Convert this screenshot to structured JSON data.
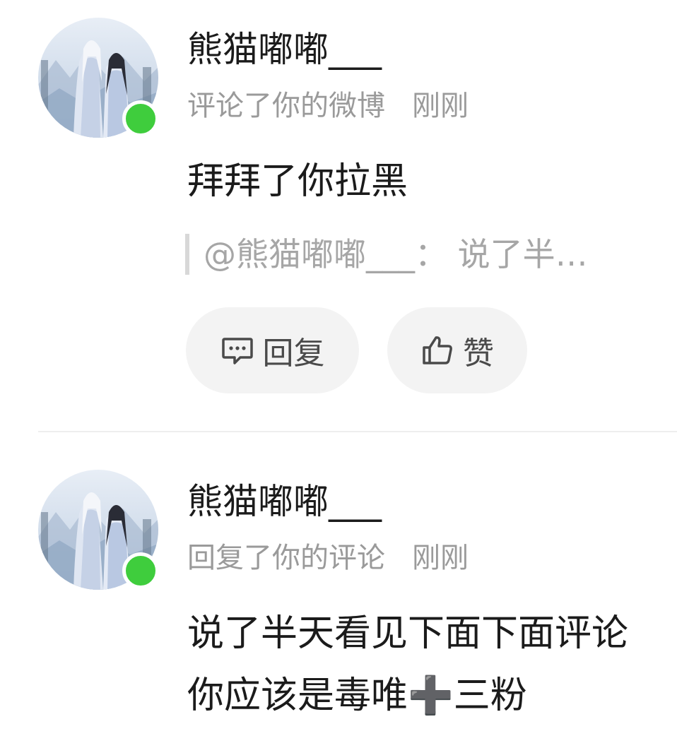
{
  "notifications": [
    {
      "user_name": "熊猫嘟嘟___",
      "action": "评论了你的微博",
      "time": "刚刚",
      "comment": "拜拜了你拉黑",
      "quote": "@熊猫嘟嘟___： 说了半…",
      "reply_label": "回复",
      "like_label": "赞",
      "avatar_icon": "couple-illustration-avatar",
      "online": true
    },
    {
      "user_name": "熊猫嘟嘟___",
      "action": "回复了你的评论",
      "time": "刚刚",
      "comment": "说了半天看见下面下面评论你应该是毒唯➕三粉",
      "avatar_icon": "couple-illustration-avatar",
      "online": true
    }
  ],
  "colors": {
    "online_dot": "#3fcd3d",
    "primary_text": "#1b1b1b",
    "secondary_text": "#9a9a9a",
    "button_bg": "#f3f3f3"
  }
}
